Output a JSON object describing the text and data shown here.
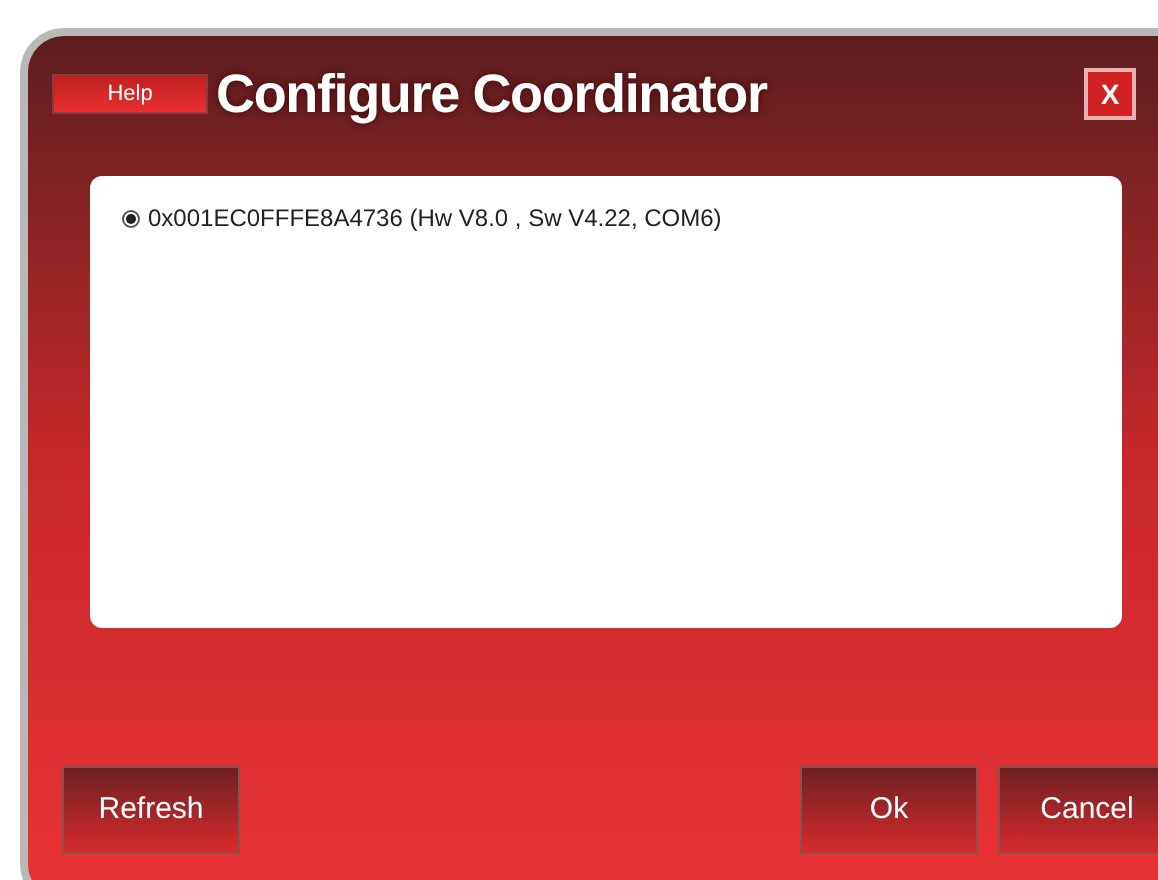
{
  "window": {
    "title": "Configure Coordinator",
    "help_button": "Help",
    "close_button": "X"
  },
  "devices": [
    {
      "label": "0x001EC0FFFE8A4736 (Hw V8.0 , Sw V4.22, COM6)",
      "selected": true
    }
  ],
  "buttons": [
    {
      "label": "Refresh",
      "kind": "left"
    },
    {
      "label": "Ok",
      "kind": "right"
    },
    {
      "label": "Cancel",
      "kind": "right"
    }
  ]
}
